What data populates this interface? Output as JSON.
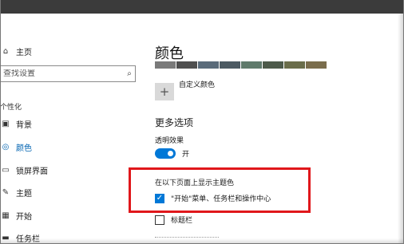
{
  "window": {
    "title_fragment": "置"
  },
  "sidebar": {
    "home": {
      "label": "主页",
      "icon": "home-icon"
    },
    "search": {
      "placeholder": "查找设置",
      "icon": "search-icon"
    },
    "section_label": "个性化",
    "items": [
      {
        "label": "背景",
        "icon": "image-icon",
        "active": false
      },
      {
        "label": "颜色",
        "icon": "palette-icon",
        "active": true
      },
      {
        "label": "锁屏界面",
        "icon": "monitor-icon",
        "active": false
      },
      {
        "label": "主题",
        "icon": "brush-icon",
        "active": false
      },
      {
        "label": "开始",
        "icon": "start-icon",
        "active": false
      },
      {
        "label": "任务栏",
        "icon": "taskbar-icon",
        "active": false
      }
    ]
  },
  "main": {
    "title": "颜色",
    "swatch_colors": [
      "#7a7a7a",
      "#4f4f4f",
      "#5a6b7a",
      "#4c5a62",
      "#5f7a6b",
      "#4d5a4a",
      "#6a6d4a",
      "#7a6d4c"
    ],
    "custom_color_label": "自定义颜色",
    "more_options_title": "更多选项",
    "transparency": {
      "label": "透明效果",
      "state_label": "开",
      "on": true
    },
    "accent_heading": "在以下页面上显示主题色",
    "checkboxes": [
      {
        "label": "\"开始\"菜单、任务栏和操作中心",
        "checked": true
      },
      {
        "label": "标题栏",
        "checked": false
      }
    ]
  },
  "colors": {
    "accent": "#0078d7",
    "highlight": "#e0171b"
  }
}
